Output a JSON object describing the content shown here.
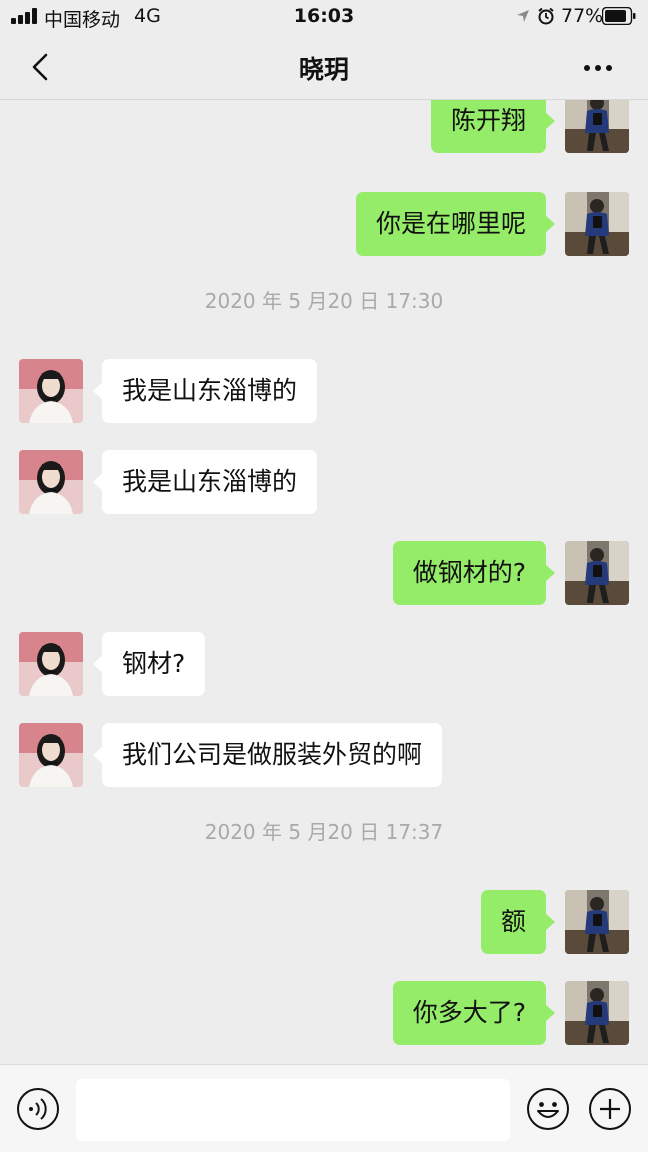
{
  "status_bar": {
    "carrier": "中国移动",
    "network": "4G",
    "time": "16:03",
    "battery": "77%"
  },
  "nav": {
    "title": "晓玥",
    "back_icon": "chevron-left-icon",
    "more_icon": "more-dots-icon"
  },
  "messages": [
    {
      "type": "message",
      "side": "out",
      "text": "陈开翔"
    },
    {
      "type": "message",
      "side": "out",
      "text": "你是在哪里呢"
    },
    {
      "type": "time",
      "text": "2020 年 5 月20 日 17:30"
    },
    {
      "type": "message",
      "side": "in",
      "text": "我是山东淄博的"
    },
    {
      "type": "message",
      "side": "in",
      "text": "我是山东淄博的"
    },
    {
      "type": "message",
      "side": "out",
      "text": "做钢材的?"
    },
    {
      "type": "message",
      "side": "in",
      "text": "钢材?"
    },
    {
      "type": "message",
      "side": "in",
      "text": "我们公司是做服装外贸的啊"
    },
    {
      "type": "time",
      "text": "2020 年 5 月20 日 17:37"
    },
    {
      "type": "message",
      "side": "out",
      "text": "额"
    },
    {
      "type": "message",
      "side": "out",
      "text": "你多大了?"
    },
    {
      "type": "message",
      "side": "in",
      "text": ""
    }
  ],
  "input_bar": {
    "placeholder": "",
    "voice_icon": "voice-icon",
    "emoji_icon": "emoji-icon",
    "plus_icon": "plus-icon"
  },
  "colors": {
    "background": "#ededed",
    "outgoing_bubble": "#95ec69",
    "incoming_bubble": "#ffffff",
    "timestamp_text": "#a9a9a9"
  }
}
